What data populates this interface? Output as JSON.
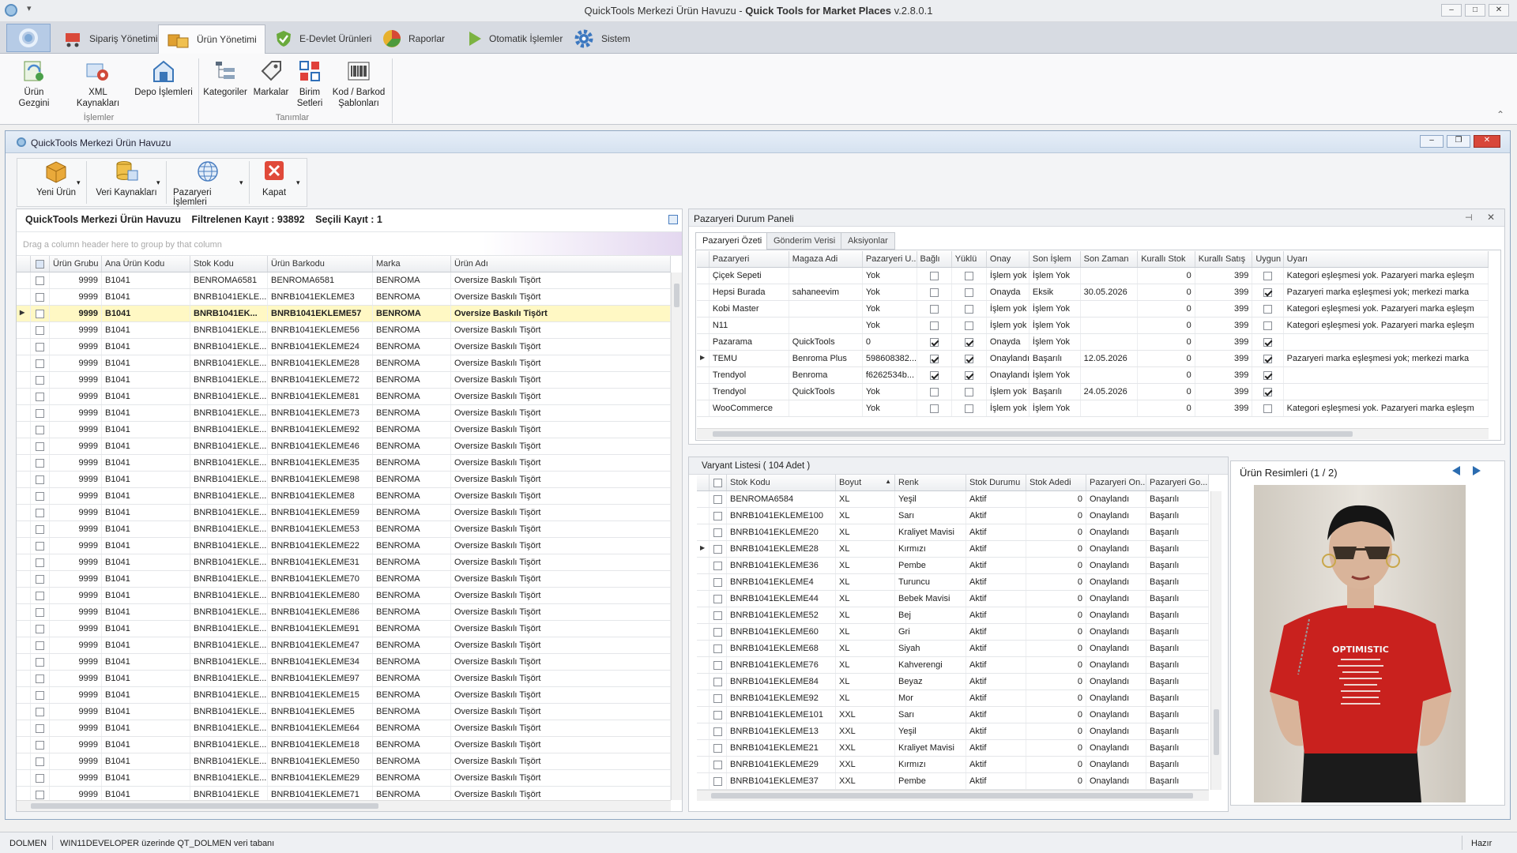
{
  "window": {
    "title_plain": "QuickTools Merkezi Ürün Havuzu - ",
    "title_bold": "Quick Tools for Market Places",
    "title_version": " v.2.8.0.1"
  },
  "tabs": [
    {
      "label": "Sipariş Yönetimi",
      "icon": "cart-icon"
    },
    {
      "label": "Ürün Yönetimi",
      "icon": "boxes-icon",
      "active": true
    },
    {
      "label": "E-Devlet Ürünleri",
      "icon": "check-shield-icon"
    },
    {
      "label": "Raporlar",
      "icon": "pie-chart-icon"
    },
    {
      "label": "Otomatik İşlemler",
      "icon": "play-icon"
    },
    {
      "label": "Sistem",
      "icon": "gear-icon"
    }
  ],
  "ribbon": {
    "buttons": [
      "Ürün Gezgini",
      "XML Kaynakları",
      "Depo İşlemleri",
      "Kategoriler",
      "Markalar",
      "Birim Setleri",
      "Kod / Barkod Şablonları"
    ],
    "group1": "İşlemler",
    "group2": "Tanımlar"
  },
  "child": {
    "title": "QuickTools Merkezi Ürün Havuzu",
    "toolbar": [
      "Yeni Ürün",
      "Veri Kaynakları",
      "Pazaryeri İşlemleri",
      "Kapat"
    ]
  },
  "left": {
    "title": "QuickTools Merkezi Ürün Havuzu",
    "filter_label": "Filtrelenen Kayıt : 93892",
    "selected_label": "Seçili Kayıt : 1",
    "group_hint": "Drag a column header here to group by that column",
    "columns": [
      "Ürün Grubu",
      "Ana Ürün Kodu",
      "Stok Kodu",
      "Ürün Barkodu",
      "Marka",
      "Ürün Adı"
    ],
    "rows": [
      [
        "9999",
        "B1041",
        "BENROMA6581",
        "BENROMA6581",
        "BENROMA",
        "Oversize Baskılı Tişört"
      ],
      [
        "9999",
        "B1041",
        "BNRB1041EKLE...",
        "BNRB1041EKLEME3",
        "BENROMA",
        "Oversize Baskılı Tişört"
      ],
      [
        "9999",
        "B1041",
        "BNRB1041EK...",
        "BNRB1041EKLEME57",
        "BENROMA",
        "Oversize Baskılı Tişört"
      ],
      [
        "9999",
        "B1041",
        "BNRB1041EKLE...",
        "BNRB1041EKLEME56",
        "BENROMA",
        "Oversize Baskılı Tişört"
      ],
      [
        "9999",
        "B1041",
        "BNRB1041EKLE...",
        "BNRB1041EKLEME24",
        "BENROMA",
        "Oversize Baskılı Tişört"
      ],
      [
        "9999",
        "B1041",
        "BNRB1041EKLE...",
        "BNRB1041EKLEME28",
        "BENROMA",
        "Oversize Baskılı Tişört"
      ],
      [
        "9999",
        "B1041",
        "BNRB1041EKLE...",
        "BNRB1041EKLEME72",
        "BENROMA",
        "Oversize Baskılı Tişört"
      ],
      [
        "9999",
        "B1041",
        "BNRB1041EKLE...",
        "BNRB1041EKLEME81",
        "BENROMA",
        "Oversize Baskılı Tişört"
      ],
      [
        "9999",
        "B1041",
        "BNRB1041EKLE...",
        "BNRB1041EKLEME73",
        "BENROMA",
        "Oversize Baskılı Tişört"
      ],
      [
        "9999",
        "B1041",
        "BNRB1041EKLE...",
        "BNRB1041EKLEME92",
        "BENROMA",
        "Oversize Baskılı Tişört"
      ],
      [
        "9999",
        "B1041",
        "BNRB1041EKLE...",
        "BNRB1041EKLEME46",
        "BENROMA",
        "Oversize Baskılı Tişört"
      ],
      [
        "9999",
        "B1041",
        "BNRB1041EKLE...",
        "BNRB1041EKLEME35",
        "BENROMA",
        "Oversize Baskılı Tişört"
      ],
      [
        "9999",
        "B1041",
        "BNRB1041EKLE...",
        "BNRB1041EKLEME98",
        "BENROMA",
        "Oversize Baskılı Tişört"
      ],
      [
        "9999",
        "B1041",
        "BNRB1041EKLE...",
        "BNRB1041EKLEME8",
        "BENROMA",
        "Oversize Baskılı Tişört"
      ],
      [
        "9999",
        "B1041",
        "BNRB1041EKLE...",
        "BNRB1041EKLEME59",
        "BENROMA",
        "Oversize Baskılı Tişört"
      ],
      [
        "9999",
        "B1041",
        "BNRB1041EKLE...",
        "BNRB1041EKLEME53",
        "BENROMA",
        "Oversize Baskılı Tişört"
      ],
      [
        "9999",
        "B1041",
        "BNRB1041EKLE...",
        "BNRB1041EKLEME22",
        "BENROMA",
        "Oversize Baskılı Tişört"
      ],
      [
        "9999",
        "B1041",
        "BNRB1041EKLE...",
        "BNRB1041EKLEME31",
        "BENROMA",
        "Oversize Baskılı Tişört"
      ],
      [
        "9999",
        "B1041",
        "BNRB1041EKLE...",
        "BNRB1041EKLEME70",
        "BENROMA",
        "Oversize Baskılı Tişört"
      ],
      [
        "9999",
        "B1041",
        "BNRB1041EKLE...",
        "BNRB1041EKLEME80",
        "BENROMA",
        "Oversize Baskılı Tişört"
      ],
      [
        "9999",
        "B1041",
        "BNRB1041EKLE...",
        "BNRB1041EKLEME86",
        "BENROMA",
        "Oversize Baskılı Tişört"
      ],
      [
        "9999",
        "B1041",
        "BNRB1041EKLE...",
        "BNRB1041EKLEME91",
        "BENROMA",
        "Oversize Baskılı Tişört"
      ],
      [
        "9999",
        "B1041",
        "BNRB1041EKLE...",
        "BNRB1041EKLEME47",
        "BENROMA",
        "Oversize Baskılı Tişört"
      ],
      [
        "9999",
        "B1041",
        "BNRB1041EKLE...",
        "BNRB1041EKLEME34",
        "BENROMA",
        "Oversize Baskılı Tişört"
      ],
      [
        "9999",
        "B1041",
        "BNRB1041EKLE...",
        "BNRB1041EKLEME97",
        "BENROMA",
        "Oversize Baskılı Tişört"
      ],
      [
        "9999",
        "B1041",
        "BNRB1041EKLE...",
        "BNRB1041EKLEME15",
        "BENROMA",
        "Oversize Baskılı Tişört"
      ],
      [
        "9999",
        "B1041",
        "BNRB1041EKLE...",
        "BNRB1041EKLEME5",
        "BENROMA",
        "Oversize Baskılı Tişört"
      ],
      [
        "9999",
        "B1041",
        "BNRB1041EKLE...",
        "BNRB1041EKLEME64",
        "BENROMA",
        "Oversize Baskılı Tişört"
      ],
      [
        "9999",
        "B1041",
        "BNRB1041EKLE...",
        "BNRB1041EKLEME18",
        "BENROMA",
        "Oversize Baskılı Tişört"
      ],
      [
        "9999",
        "B1041",
        "BNRB1041EKLE...",
        "BNRB1041EKLEME50",
        "BENROMA",
        "Oversize Baskılı Tişört"
      ],
      [
        "9999",
        "B1041",
        "BNRB1041EKLE...",
        "BNRB1041EKLEME29",
        "BENROMA",
        "Oversize Baskılı Tişört"
      ],
      [
        "9999",
        "B1041",
        "BNRB1041EKLE",
        "BNRB1041EKLEME71",
        "BENROMA",
        "Oversize Baskılı Tişört"
      ]
    ],
    "selected_index": 2
  },
  "market": {
    "title": "Pazaryeri Durum Paneli",
    "subtabs": [
      "Pazaryeri Özeti",
      "Gönderim Verisi",
      "Aksiyonlar"
    ],
    "columns": [
      "Pazaryeri",
      "Magaza Adi",
      "Pazaryeri U...",
      "Bağlı",
      "Yüklü",
      "Onay",
      "Son İşlem",
      "Son Zaman",
      "Kurallı Stok",
      "Kurallı Satış",
      "Uygun",
      "Uyarı"
    ],
    "rows": [
      {
        "cells": [
          "Çiçek Sepeti",
          "",
          "Yok",
          "",
          "",
          "İşlem yok",
          "İşlem Yok",
          "",
          "0",
          "399",
          "",
          "Kategori eşleşmesi yok. Pazaryeri marka eşleşm"
        ],
        "bagli": false,
        "yuklu": false,
        "uygun": false
      },
      {
        "cells": [
          "Hepsi Burada",
          "sahaneevim",
          "Yok",
          "",
          "",
          "Onayda",
          "Eksik",
          "30.05.2026",
          "0",
          "399",
          "",
          "Pazaryeri marka eşleşmesi yok; merkezi marka"
        ],
        "bagli": false,
        "yuklu": false,
        "uygun": true
      },
      {
        "cells": [
          "Kobi Master",
          "",
          "Yok",
          "",
          "",
          "İşlem yok",
          "İşlem Yok",
          "",
          "0",
          "399",
          "",
          "Kategori eşleşmesi yok. Pazaryeri marka eşleşm"
        ],
        "bagli": false,
        "yuklu": false,
        "uygun": false
      },
      {
        "cells": [
          "N11",
          "",
          "Yok",
          "",
          "",
          "İşlem yok",
          "İşlem Yok",
          "",
          "0",
          "399",
          "",
          "Kategori eşleşmesi yok. Pazaryeri marka eşleşm"
        ],
        "bagli": false,
        "yuklu": false,
        "uygun": false
      },
      {
        "cells": [
          "Pazarama",
          "QuickTools",
          "0",
          "",
          "",
          "Onayda",
          "İşlem Yok",
          "",
          "0",
          "399",
          "",
          ""
        ],
        "bagli": true,
        "yuklu": true,
        "uygun": true
      },
      {
        "cells": [
          "TEMU",
          "Benroma Plus",
          "598608382...",
          "",
          "",
          "Onaylandı",
          "Başarılı",
          "12.05.2026",
          "0",
          "399",
          "",
          "Pazaryeri marka eşleşmesi yok; merkezi marka"
        ],
        "bagli": true,
        "yuklu": true,
        "uygun": true
      },
      {
        "cells": [
          "Trendyol",
          "Benroma",
          "f6262534b...",
          "",
          "",
          "Onaylandı",
          "İşlem Yok",
          "",
          "0",
          "399",
          "",
          ""
        ],
        "bagli": true,
        "yuklu": true,
        "uygun": true
      },
      {
        "cells": [
          "Trendyol",
          "QuickTools",
          "Yok",
          "",
          "",
          "İşlem yok",
          "Başarılı",
          "24.05.2026",
          "0",
          "399",
          "",
          ""
        ],
        "bagli": false,
        "yuklu": false,
        "uygun": true
      },
      {
        "cells": [
          "WooCommerce",
          "",
          "Yok",
          "",
          "",
          "İşlem yok",
          "İşlem Yok",
          "",
          "0",
          "399",
          "",
          "Kategori eşleşmesi yok. Pazaryeri marka eşleşm"
        ],
        "bagli": false,
        "yuklu": false,
        "uygun": false
      }
    ]
  },
  "variants": {
    "title": "Varyant Listesi ( 104 Adet )",
    "columns": [
      "Stok Kodu",
      "Boyut",
      "Renk",
      "Stok Durumu",
      "Stok Adedi",
      "Pazaryeri On...",
      "Pazaryeri Go..."
    ],
    "rows": [
      [
        "BENROMA6584",
        "XL",
        "Yeşil",
        "Aktif",
        "0",
        "Onaylandı",
        "Başarılı"
      ],
      [
        "BNRB1041EKLEME100",
        "XL",
        "Sarı",
        "Aktif",
        "0",
        "Onaylandı",
        "Başarılı"
      ],
      [
        "BNRB1041EKLEME20",
        "XL",
        "Kraliyet Mavisi",
        "Aktif",
        "0",
        "Onaylandı",
        "Başarılı"
      ],
      [
        "BNRB1041EKLEME28",
        "XL",
        "Kırmızı",
        "Aktif",
        "0",
        "Onaylandı",
        "Başarılı"
      ],
      [
        "BNRB1041EKLEME36",
        "XL",
        "Pembe",
        "Aktif",
        "0",
        "Onaylandı",
        "Başarılı"
      ],
      [
        "BNRB1041EKLEME4",
        "XL",
        "Turuncu",
        "Aktif",
        "0",
        "Onaylandı",
        "Başarılı"
      ],
      [
        "BNRB1041EKLEME44",
        "XL",
        "Bebek Mavisi",
        "Aktif",
        "0",
        "Onaylandı",
        "Başarılı"
      ],
      [
        "BNRB1041EKLEME52",
        "XL",
        "Bej",
        "Aktif",
        "0",
        "Onaylandı",
        "Başarılı"
      ],
      [
        "BNRB1041EKLEME60",
        "XL",
        "Gri",
        "Aktif",
        "0",
        "Onaylandı",
        "Başarılı"
      ],
      [
        "BNRB1041EKLEME68",
        "XL",
        "Siyah",
        "Aktif",
        "0",
        "Onaylandı",
        "Başarılı"
      ],
      [
        "BNRB1041EKLEME76",
        "XL",
        "Kahverengi",
        "Aktif",
        "0",
        "Onaylandı",
        "Başarılı"
      ],
      [
        "BNRB1041EKLEME84",
        "XL",
        "Beyaz",
        "Aktif",
        "0",
        "Onaylandı",
        "Başarılı"
      ],
      [
        "BNRB1041EKLEME92",
        "XL",
        "Mor",
        "Aktif",
        "0",
        "Onaylandı",
        "Başarılı"
      ],
      [
        "BNRB1041EKLEME101",
        "XXL",
        "Sarı",
        "Aktif",
        "0",
        "Onaylandı",
        "Başarılı"
      ],
      [
        "BNRB1041EKLEME13",
        "XXL",
        "Yeşil",
        "Aktif",
        "0",
        "Onaylandı",
        "Başarılı"
      ],
      [
        "BNRB1041EKLEME21",
        "XXL",
        "Kraliyet Mavisi",
        "Aktif",
        "0",
        "Onaylandı",
        "Başarılı"
      ],
      [
        "BNRB1041EKLEME29",
        "XXL",
        "Kırmızı",
        "Aktif",
        "0",
        "Onaylandı",
        "Başarılı"
      ],
      [
        "BNRB1041EKLEME37",
        "XXL",
        "Pembe",
        "Aktif",
        "0",
        "Onaylandı",
        "Başarılı"
      ]
    ]
  },
  "images": {
    "title": "Ürün Resimleri (1 / 2)",
    "shirt_text": "OPTIMISTIC"
  },
  "status": {
    "user": "DOLMEN",
    "db": "WIN11DEVELOPER üzerinde QT_DOLMEN veri tabanı",
    "state": "Hazır"
  },
  "colors": {
    "accent": "#2b6cb0",
    "selected_row": "#fff8c4",
    "close_red": "#e04a3a"
  }
}
